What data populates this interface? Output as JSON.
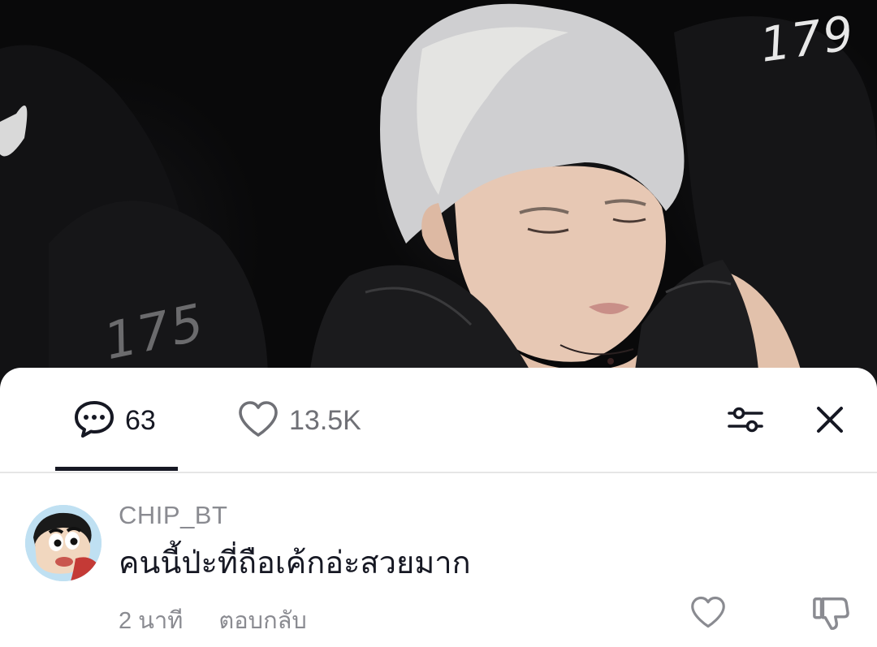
{
  "video": {
    "numbers": [
      "179",
      "175"
    ]
  },
  "tabs": {
    "comments": {
      "icon": "comment-bubble-icon",
      "count": "63"
    },
    "likes": {
      "icon": "heart-icon",
      "count": "13.5K"
    }
  },
  "actions": {
    "filter_icon": "sliders-icon",
    "close_icon": "close-icon"
  },
  "comment": {
    "username": "CHIP_BT",
    "text": "คนนี้ป่ะที่ถือเค้กอ่ะสวยมาก",
    "time": "2 นาที",
    "reply_label": "ตอบกลับ",
    "like_icon": "heart-outline-icon",
    "dislike_icon": "thumbs-down-icon"
  },
  "colors": {
    "text_primary": "#161823",
    "text_secondary": "#8a8b91",
    "sheet_background": "#ffffff",
    "divider": "#e6e6e6"
  }
}
